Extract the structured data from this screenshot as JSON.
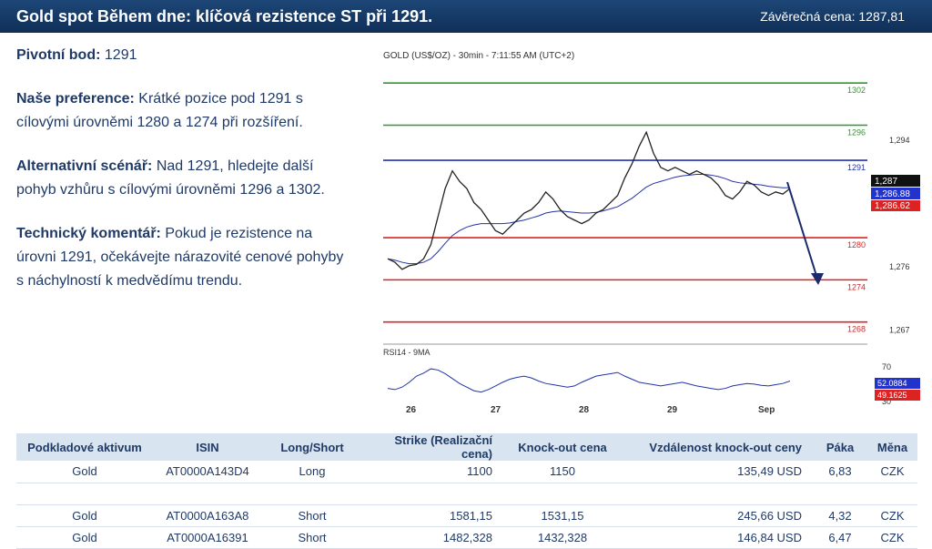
{
  "header": {
    "title": "Gold spot Během dne: klíčová rezistence ST při 1291.",
    "closing": "Závěrečná cena: 1287,81"
  },
  "analysis": {
    "pivot_label": "Pivotní bod:",
    "pivot_value": "1291",
    "pref_label": "Naše preference:",
    "pref_text": "Krátké pozice pod 1291 s cílovými úrovněmi 1280 a 1274 při  rozšíření.",
    "alt_label": "Alternativní scénář:",
    "alt_text": "Nad 1291, hledejte další pohyb vzhůru s cílovými úrovněmi 1296 a 1302.",
    "tech_label": "Technický komentář:",
    "tech_text": "Pokud je rezistence na úrovni 1291, očekávejte nárazovité cenové pohyby s náchylností k medvědímu trendu."
  },
  "chart_data": {
    "type": "line",
    "instrument_label": "GOLD (US$/OZ) - 30min - 7:11:55 AM (UTC+2)",
    "x_labels": [
      "26",
      "27",
      "28",
      "29",
      "Sep"
    ],
    "y_ticks": [
      "1,294",
      "1,276",
      "1,267"
    ],
    "ylim": [
      1265.5,
      1305
    ],
    "levels": [
      {
        "value": 1302,
        "label": "1302",
        "color": "#2e9a2e"
      },
      {
        "value": 1296,
        "label": "1296",
        "color": "#2e9a2e"
      },
      {
        "value": 1291,
        "label": "1291",
        "color": "#2233aa"
      },
      {
        "value": 1280,
        "label": "1280",
        "color": "#dd2222"
      },
      {
        "value": 1274,
        "label": "1274",
        "color": "#dd2222"
      },
      {
        "value": 1268,
        "label": "1268",
        "color": "#dd2222"
      }
    ],
    "price": [
      1277,
      1276.5,
      1275.5,
      1276,
      1276.2,
      1277,
      1279,
      1283,
      1287,
      1289.5,
      1288,
      1287,
      1285,
      1284,
      1282.5,
      1281,
      1280.5,
      1281.5,
      1282.5,
      1283.5,
      1284,
      1285,
      1286.5,
      1285.5,
      1284,
      1283,
      1282.5,
      1282,
      1282.5,
      1283.5,
      1284,
      1285,
      1286,
      1288.5,
      1290.5,
      1293,
      1295,
      1292,
      1290,
      1289.5,
      1290,
      1289.5,
      1289,
      1289.5,
      1289,
      1288.5,
      1287.5,
      1286,
      1285.5,
      1286.5,
      1288,
      1287.5,
      1286.5,
      1286,
      1286.5,
      1286.2,
      1287
    ],
    "ma": [
      1277,
      1276.8,
      1276.5,
      1276.3,
      1276.3,
      1276.5,
      1277,
      1278,
      1279.2,
      1280.3,
      1281,
      1281.5,
      1281.8,
      1282,
      1282,
      1282,
      1282,
      1282.1,
      1282.3,
      1282.5,
      1282.8,
      1283.1,
      1283.5,
      1283.7,
      1283.8,
      1283.7,
      1283.6,
      1283.5,
      1283.5,
      1283.6,
      1283.8,
      1284.1,
      1284.4,
      1285,
      1285.6,
      1286.4,
      1287.2,
      1287.7,
      1288,
      1288.3,
      1288.6,
      1288.8,
      1288.9,
      1289,
      1289,
      1288.9,
      1288.7,
      1288.4,
      1288,
      1287.8,
      1287.7,
      1287.6,
      1287.5,
      1287.3,
      1287.2,
      1287.1,
      1287.1
    ],
    "last_price": "1,287",
    "ma_value": "1,286.88",
    "ma2_value": "1,286.62",
    "rsi": {
      "label": "RSI14 - 9MA",
      "tick": "70",
      "tick_low": "30",
      "value": "52.0884",
      "ma_value": "49.1625",
      "values": [
        40,
        38,
        42,
        50,
        60,
        65,
        72,
        70,
        64,
        56,
        48,
        42,
        36,
        34,
        38,
        44,
        50,
        55,
        58,
        60,
        57,
        52,
        48,
        46,
        44,
        42,
        44,
        50,
        55,
        60,
        62,
        64,
        66,
        60,
        55,
        50,
        48,
        46,
        44,
        46,
        48,
        50,
        47,
        44,
        42,
        40,
        38,
        40,
        44,
        46,
        48,
        47,
        45,
        44,
        46,
        48,
        52
      ]
    },
    "annotation_arrow": "down"
  },
  "table": {
    "headers": [
      "Podkladové aktivum",
      "ISIN",
      "Long/Short",
      "Strike (Realizační cena)",
      "Knock-out cena",
      "Vzdálenost knock-out ceny",
      "Páka",
      "Měna"
    ],
    "rows": [
      [
        "Gold",
        "AT0000A143D4",
        "Long",
        "1100",
        "1150",
        "135,49 USD",
        "6,83",
        "CZK"
      ],
      [
        "",
        "",
        "",
        "",
        "",
        "",
        "",
        ""
      ],
      [
        "Gold",
        "AT0000A163A8",
        "Short",
        "1581,15",
        "1531,15",
        "245,66 USD",
        "4,32",
        "CZK"
      ],
      [
        "Gold",
        "AT0000A16391",
        "Short",
        "1482,328",
        "1432,328",
        "146,84 USD",
        "6,47",
        "CZK"
      ]
    ]
  }
}
